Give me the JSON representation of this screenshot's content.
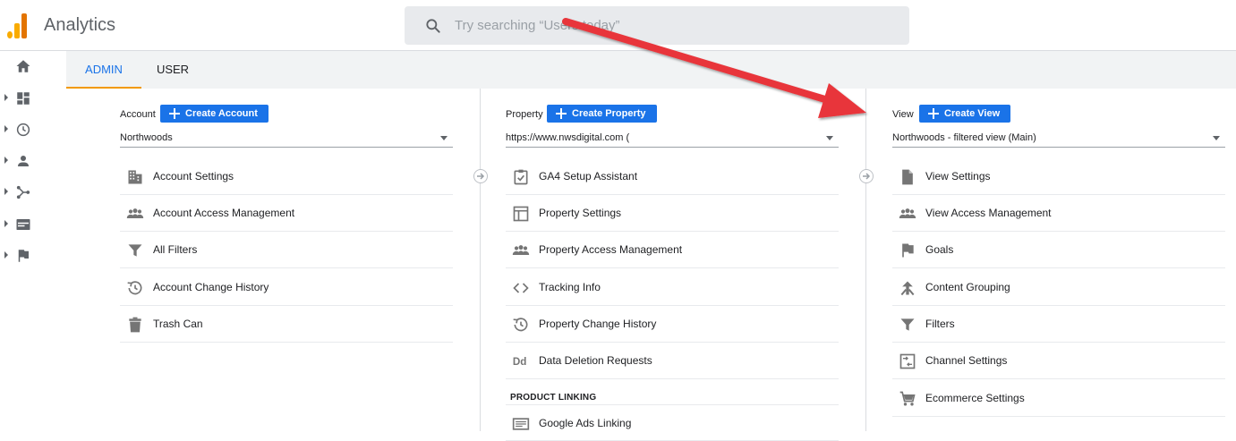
{
  "app": {
    "title": "Analytics"
  },
  "search": {
    "placeholder": "Try searching “Users today”"
  },
  "tabs": [
    {
      "label": "ADMIN"
    },
    {
      "label": "USER"
    }
  ],
  "account": {
    "label": "Account",
    "create_label": "Create Account",
    "selected": "Northwoods",
    "items": [
      {
        "label": "Account Settings",
        "icon": "building-icon"
      },
      {
        "label": "Account Access Management",
        "icon": "people-icon"
      },
      {
        "label": "All Filters",
        "icon": "filter-icon"
      },
      {
        "label": "Account Change History",
        "icon": "history-icon"
      },
      {
        "label": "Trash Can",
        "icon": "trash-icon"
      }
    ]
  },
  "property": {
    "label": "Property",
    "create_label": "Create Property",
    "selected": "https://www.nwsdigital.com (",
    "items": [
      {
        "label": "GA4 Setup Assistant",
        "icon": "checklist-icon"
      },
      {
        "label": "Property Settings",
        "icon": "layout-icon"
      },
      {
        "label": "Property Access Management",
        "icon": "people-icon"
      },
      {
        "label": "Tracking Info",
        "icon": "code-icon"
      },
      {
        "label": "Property Change History",
        "icon": "history-icon"
      },
      {
        "label": "Data Deletion Requests",
        "icon": "dd-icon"
      }
    ],
    "section_title": "PRODUCT LINKING",
    "linking_items": [
      {
        "label": "Google Ads Linking",
        "icon": "ads-icon"
      }
    ]
  },
  "view": {
    "label": "View",
    "create_label": "Create View",
    "selected": "Northwoods - filtered view (Main)",
    "items": [
      {
        "label": "View Settings",
        "icon": "document-icon"
      },
      {
        "label": "View Access Management",
        "icon": "people-icon"
      },
      {
        "label": "Goals",
        "icon": "flag-icon"
      },
      {
        "label": "Content Grouping",
        "icon": "grouping-icon"
      },
      {
        "label": "Filters",
        "icon": "filter-icon"
      },
      {
        "label": "Channel Settings",
        "icon": "channel-icon"
      },
      {
        "label": "Ecommerce Settings",
        "icon": "cart-icon"
      }
    ]
  },
  "left_nav": [
    {
      "icon": "home-icon"
    },
    {
      "icon": "dashboard-icon"
    },
    {
      "icon": "clock-icon"
    },
    {
      "icon": "person-icon"
    },
    {
      "icon": "acquisition-icon"
    },
    {
      "icon": "behavior-icon"
    },
    {
      "icon": "flag-icon"
    }
  ],
  "colors": {
    "accent": "#1a73e8",
    "tab_underline": "#f29900",
    "annotation_arrow": "#e8363a",
    "logo": "#f9ab00"
  }
}
